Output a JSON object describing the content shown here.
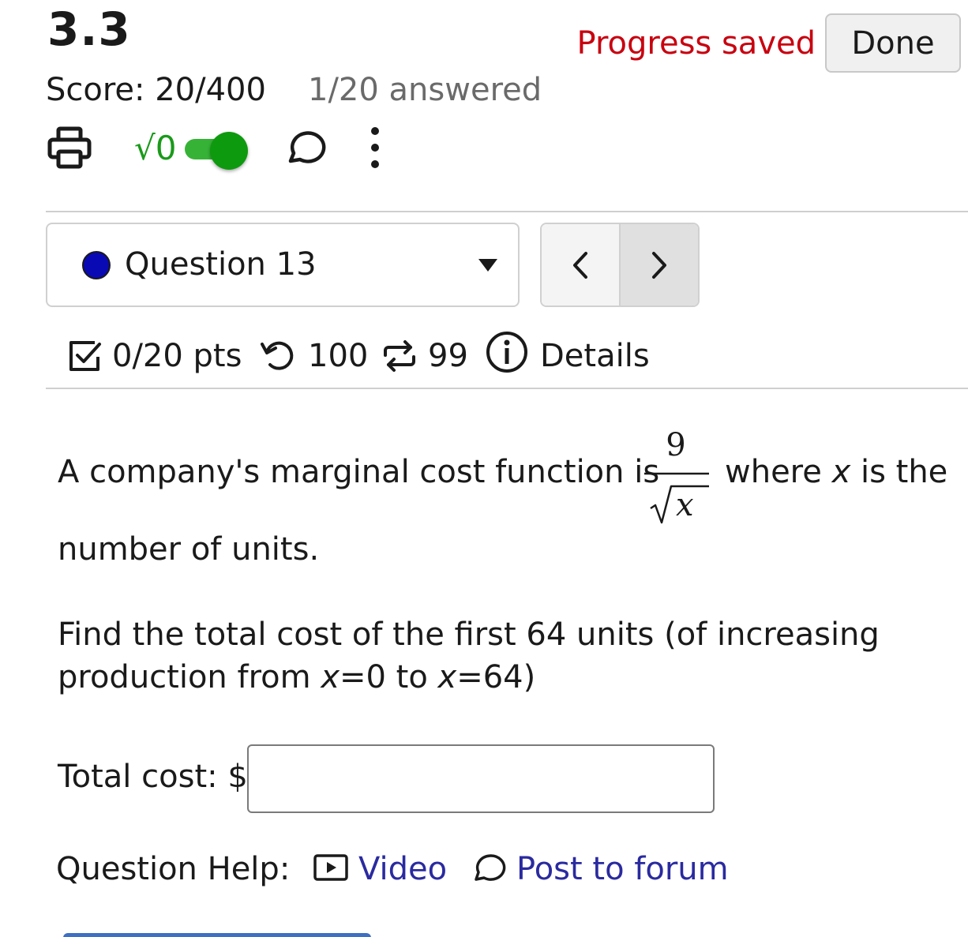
{
  "header": {
    "title": "3.3",
    "progress_status": "Progress saved",
    "done_label": "Done",
    "score": "Score: 20/400",
    "answered": "1/20 answered"
  },
  "toolbar": {
    "math_toggle_label": "√0",
    "math_toggle_on": true
  },
  "question_nav": {
    "selected": "Question 13"
  },
  "question_meta": {
    "points": "0/20 pts",
    "retries": "100",
    "attempts": "99",
    "details_label": "Details"
  },
  "question": {
    "line1_before": "A company's marginal cost function is",
    "frac_numerator": "9",
    "frac_denominator_var": "x",
    "line1_after_a": "where ",
    "line1_var": "x",
    "line1_after_b": " is the",
    "line2": "number of units.",
    "find_a": "Find the total cost of the first 64 units (of increasing",
    "find_b_1": "production from ",
    "find_b_var1": "x",
    "find_b_2": "=0 to ",
    "find_b_var2": "x",
    "find_b_3": "=64)",
    "answer_label": "Total cost: $",
    "answer_value": ""
  },
  "help": {
    "label": "Question Help:",
    "video_label": "Video",
    "forum_label": "Post to forum"
  },
  "colors": {
    "progress": "#c8000f",
    "toggle": "#0e9a0e",
    "link": "#2a2aa0",
    "question_dot": "#0a0ab4"
  }
}
